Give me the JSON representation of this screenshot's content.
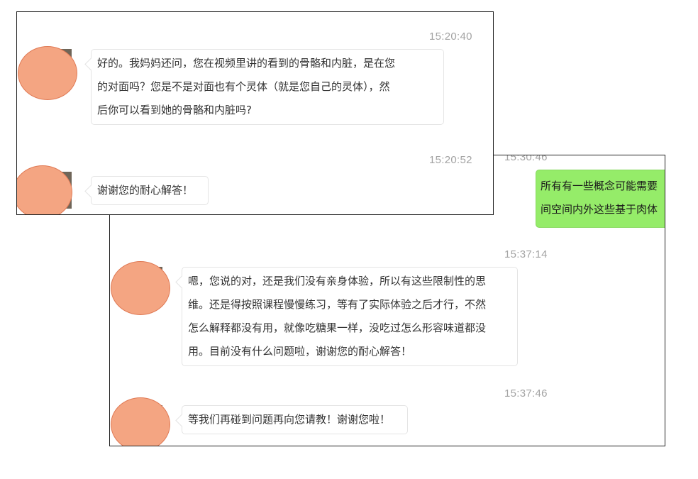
{
  "back_panel": {
    "messages": [
      {
        "time": "15:30:46",
        "sender": "self",
        "lines": [
          "所有有一些概念可能需要",
          "间空间内外这些基于肉体"
        ]
      },
      {
        "time": "15:37:14",
        "sender": "other",
        "lines": [
          "嗯，您说的对，还是我们没有亲身体验，所以有这些限制性的思",
          "维。还是得按照课程慢慢练习，等有了实际体验之后才行，不然",
          "怎么解释都没有用，就像吃糖果一样，没吃过怎么形容味道都没",
          "用。目前没有什么问题啦，谢谢您的耐心解答！"
        ]
      },
      {
        "time": "15:37:46",
        "sender": "other",
        "lines": [
          "等我们再碰到问题再向您请教！谢谢您啦！"
        ]
      }
    ]
  },
  "front_panel": {
    "messages": [
      {
        "time": "15:20:40",
        "sender": "other",
        "lines": [
          "好的。我妈妈还问，您在视频里讲的看到的骨骼和内脏，是在您",
          "的对面吗？您是不是对面也有个灵体（就是您自己的灵体），然",
          "后你可以看到她的骨骼和内脏吗?"
        ]
      },
      {
        "time": "15:20:52",
        "sender": "other",
        "lines": [
          "谢谢您的耐心解答！"
        ]
      }
    ]
  },
  "colors": {
    "self_bubble": "#95ec69",
    "avatar_mask": "#f4a582",
    "timestamp": "#a3a3a3"
  }
}
